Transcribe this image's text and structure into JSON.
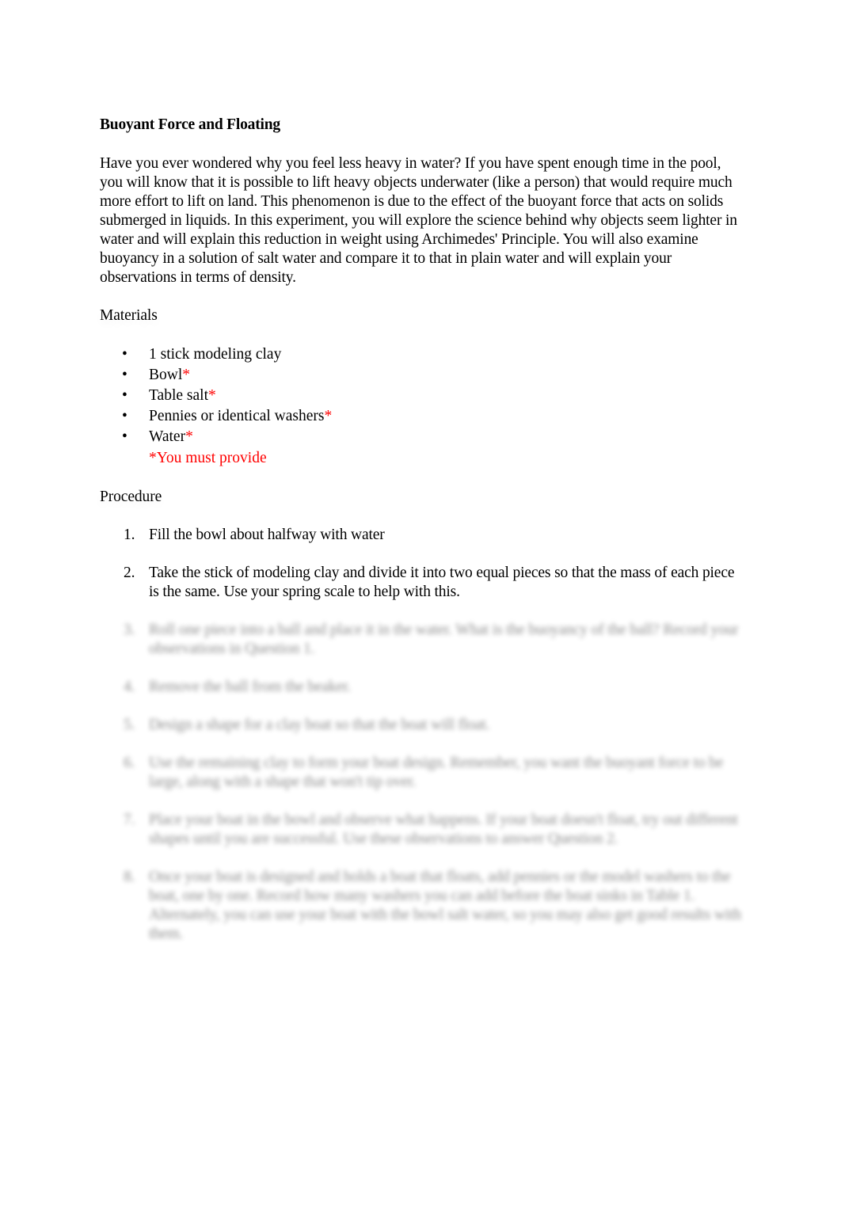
{
  "document": {
    "title": "Buoyant Force and Floating",
    "intro": "Have you ever wondered why you feel less heavy in water? If you have spent enough time in the pool, you will know that it is possible to lift heavy objects underwater (like a person) that would require much more effort to lift on land. This phenomenon is due to the effect of the buoyant force that acts on solids submerged in liquids. In this experiment, you will explore the science behind why objects seem lighter in water and will explain this reduction in weight using Archimedes' Principle. You will also examine buoyancy in a solution of salt water and compare it to that in plain water and will explain your observations in terms of density.",
    "materials": {
      "heading": "Materials",
      "bullet_glyph": "•",
      "required_marker": "*",
      "items": [
        {
          "label": "1 stick modeling clay",
          "marker": ""
        },
        {
          "label": "Bowl",
          "marker": "*"
        },
        {
          "label": "Table salt",
          "marker": "*"
        },
        {
          "label": "Pennies or identical washers",
          "marker": "*"
        },
        {
          "label": "Water",
          "marker": "*"
        }
      ],
      "footnote": "*You must provide"
    },
    "procedure": {
      "heading": "Procedure",
      "steps": [
        {
          "number": "1.",
          "text": "Fill the bowl about halfway with water",
          "blurred": false
        },
        {
          "number": "2.",
          "text": "Take the stick of modeling clay and divide it into two equal pieces so that the mass of each piece is the same. Use your spring scale to help with this.",
          "blurred": false
        },
        {
          "number": "3.",
          "text": "Roll one piece into a ball and place it in the water. What is the buoyancy of the ball? Record your observations in Question 1.",
          "blurred": true
        },
        {
          "number": "4.",
          "text": "Remove the ball from the beaker.",
          "blurred": true
        },
        {
          "number": "5.",
          "text": "Design a shape for a clay boat so that the boat will float.",
          "blurred": true
        },
        {
          "number": "6.",
          "text": "Use the remaining clay to form your boat design. Remember, you want the buoyant force to be large, along with a shape that won't tip over.",
          "blurred": true
        },
        {
          "number": "7.",
          "text": "Place your boat in the bowl and observe what happens. If your boat doesn't float, try out different shapes until you are successful. Use these observations to answer Question 2.",
          "blurred": true
        },
        {
          "number": "8.",
          "text": "Once your boat is designed and holds a boat that floats, add pennies or the model washers to the boat, one by one. Record how many washers you can add before the boat sinks in Table 1. Alternately, you can use your boat with the bowl salt water, so you may also get good results with them.",
          "blurred": true
        }
      ]
    },
    "colors": {
      "text": "#000000",
      "required": "#ff0000",
      "background": "#ffffff"
    }
  }
}
